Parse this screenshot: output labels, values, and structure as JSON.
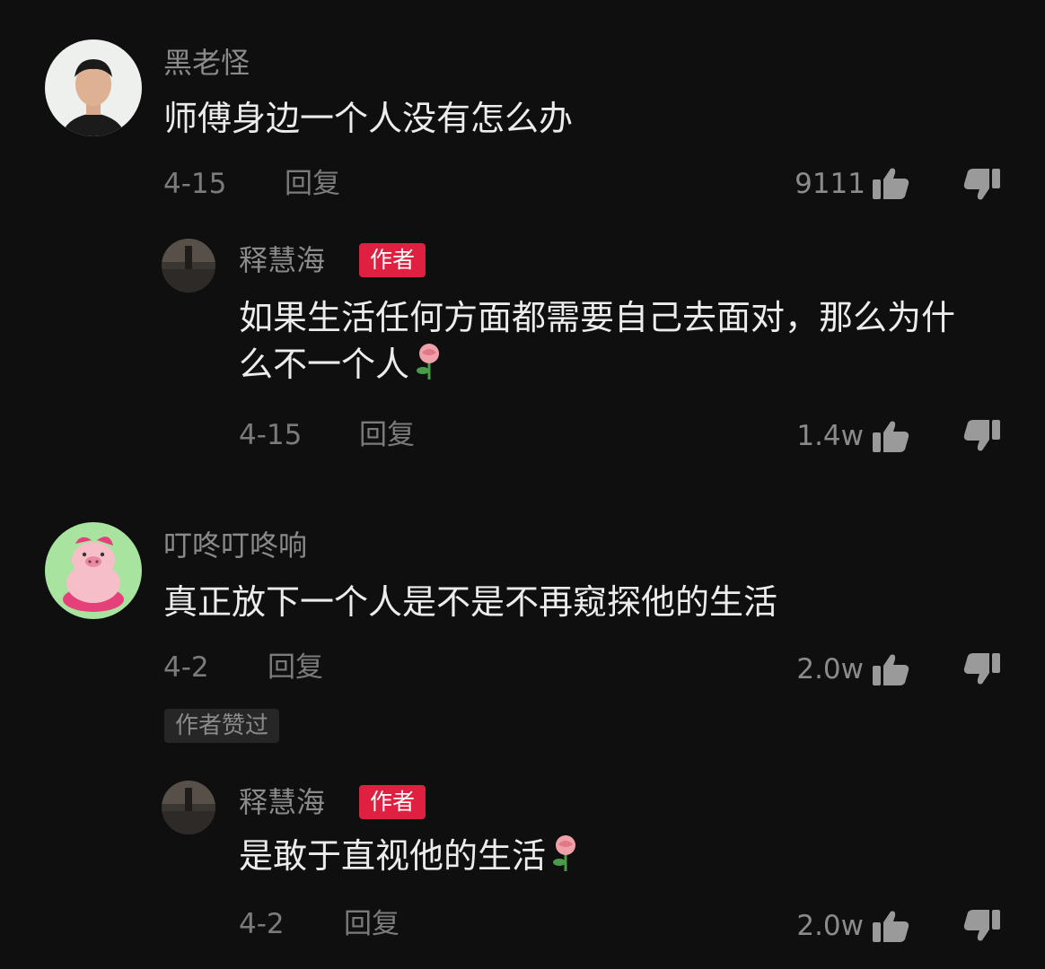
{
  "badge_author": "作者",
  "reply_label": "回复",
  "icons": {
    "like": "thumbs-up-icon",
    "dislike": "thumbs-down-icon",
    "emoji": "rose-emoji"
  },
  "colors": {
    "background": "#0f0f0f",
    "badge": "#e02040",
    "username": "#8a8a8a",
    "text": "#ececec"
  },
  "comments": [
    {
      "username": "黑老怪",
      "text": "师傅身边一个人没有怎么办",
      "date": "4-15",
      "likes": "9111",
      "reply": {
        "username": "释慧海",
        "text": "如果生活任何方面都需要自己去面对，那么为什么不一个人",
        "date": "4-15",
        "likes": "1.4w"
      }
    },
    {
      "username": "叮咚叮咚响",
      "text": "真正放下一个人是不是不再窥探他的生活",
      "date": "4-2",
      "likes": "2.0w",
      "liked_by_author": "作者赞过",
      "reply": {
        "username": "释慧海",
        "text": "是敢于直视他的生活",
        "date": "4-2",
        "likes": "2.0w"
      }
    }
  ]
}
